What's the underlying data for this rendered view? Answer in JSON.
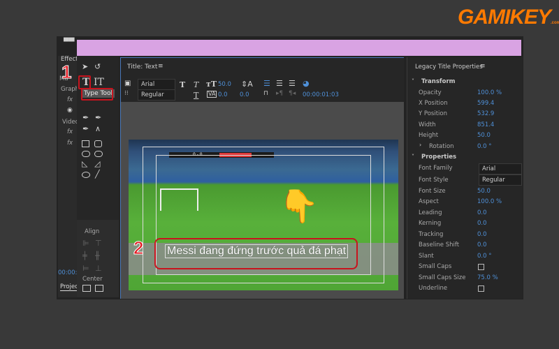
{
  "logo": {
    "text": "GAMIKEY",
    ".com": ".com"
  },
  "left_panel": {
    "items": [
      "Effect",
      "Ma",
      "Graph",
      "fx",
      "Video",
      "fx",
      "fx"
    ],
    "timecode": "00:00:0",
    "project_tab": "Projec"
  },
  "tools": {
    "tooltip": "Type Tool",
    "align_label": "Align",
    "center_label": "Center"
  },
  "title_panel": {
    "title": "Title: Text",
    "font": "Arial",
    "style": "Regular",
    "font_size": "50.0",
    "kerning": "0.0",
    "leading": "0.0",
    "timecode": "00:00:01:03"
  },
  "canvas": {
    "text": "Messi đang đứng trước quả đá phạt",
    "score": "0 - 0"
  },
  "annotations": {
    "step1": "1",
    "step2": "2"
  },
  "properties": {
    "header": "Legacy Title Properties",
    "transform_label": "Transform",
    "transform": [
      {
        "label": "Opacity",
        "value": "100.0 %"
      },
      {
        "label": "X Position",
        "value": "599.4"
      },
      {
        "label": "Y Position",
        "value": "532.9"
      },
      {
        "label": "Width",
        "value": "851.4"
      },
      {
        "label": "Height",
        "value": "50.0"
      },
      {
        "label": "Rotation",
        "value": "0.0 °"
      }
    ],
    "properties_label": "Properties",
    "font_family": {
      "label": "Font Family",
      "value": "Arial"
    },
    "font_style": {
      "label": "Font Style",
      "value": "Regular"
    },
    "props": [
      {
        "label": "Font Size",
        "value": "50.0"
      },
      {
        "label": "Aspect",
        "value": "100.0 %"
      },
      {
        "label": "Leading",
        "value": "0.0"
      },
      {
        "label": "Kerning",
        "value": "0.0"
      },
      {
        "label": "Tracking",
        "value": "0.0"
      },
      {
        "label": "Baseline Shift",
        "value": "0.0"
      },
      {
        "label": "Slant",
        "value": "0.0 °"
      }
    ],
    "small_caps": {
      "label": "Small Caps",
      "checked": false
    },
    "small_caps_size": {
      "label": "Small Caps Size",
      "value": "75.0 %"
    },
    "underline": {
      "label": "Underline",
      "checked": false
    }
  },
  "colors": {
    "accent": "#4f90d8",
    "annotation_red": "#c8141e",
    "header_bar": "#d9a3e3",
    "logo": "#ff7a00"
  }
}
